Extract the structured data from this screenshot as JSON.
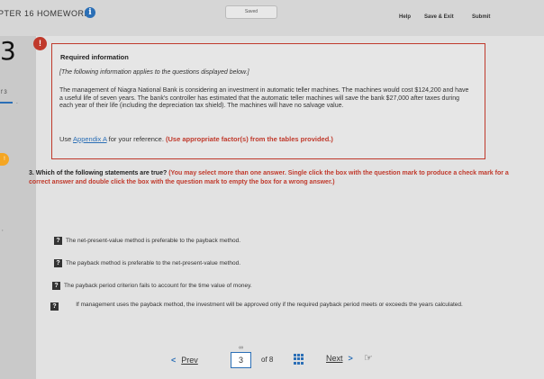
{
  "header": {
    "title": "PTER 16 HOMEWORK",
    "saved": "Saved",
    "nav": [
      "Help",
      "Save & Exit",
      "Submit"
    ]
  },
  "sidebar": {
    "question_number": "3",
    "side_label": "f 3",
    "side_dot": "-",
    "flag": "!",
    "comma": ","
  },
  "required": {
    "title": "Required information",
    "note": "[The following information applies to the questions displayed below.]",
    "body": "The management of Niagra National Bank is considering an investment in automatic teller machines. The machines would cost $124,200 and have a useful life of seven years. The bank's controller has estimated that the automatic teller machines will save the bank $27,000 after taxes during each year of their life (including the depreciation tax shield). The machines will have no salvage value.",
    "use_prefix": "Use ",
    "appendix_link": "Appendix A",
    "use_mid": " for your reference. ",
    "use_red": "(Use appropriate factor(s) from the tables provided.)"
  },
  "question": {
    "number": "3.",
    "text": "Which of the following statements are true?",
    "instructions": "(You may select more than one answer. Single click the box with the question mark to produce a check mark for a correct answer and double click the box with the question mark to empty the box for a wrong answer.)",
    "options": [
      "The net-present-value method is preferable to the payback method.",
      "The payback method is preferable to the net-present-value method.",
      "The payback period criterion fails to account for the time value of money.",
      "If management uses the payback method, the investment will be approved only if the required payback period meets or exceeds the years calculated."
    ],
    "box_glyph": "?"
  },
  "footer": {
    "prev": "Prev",
    "current_page": "3",
    "of_total": "of 8",
    "next": "Next"
  },
  "colors": {
    "accent": "#2b6fb6",
    "alert": "#c0392b",
    "flag": "#f5a623"
  }
}
